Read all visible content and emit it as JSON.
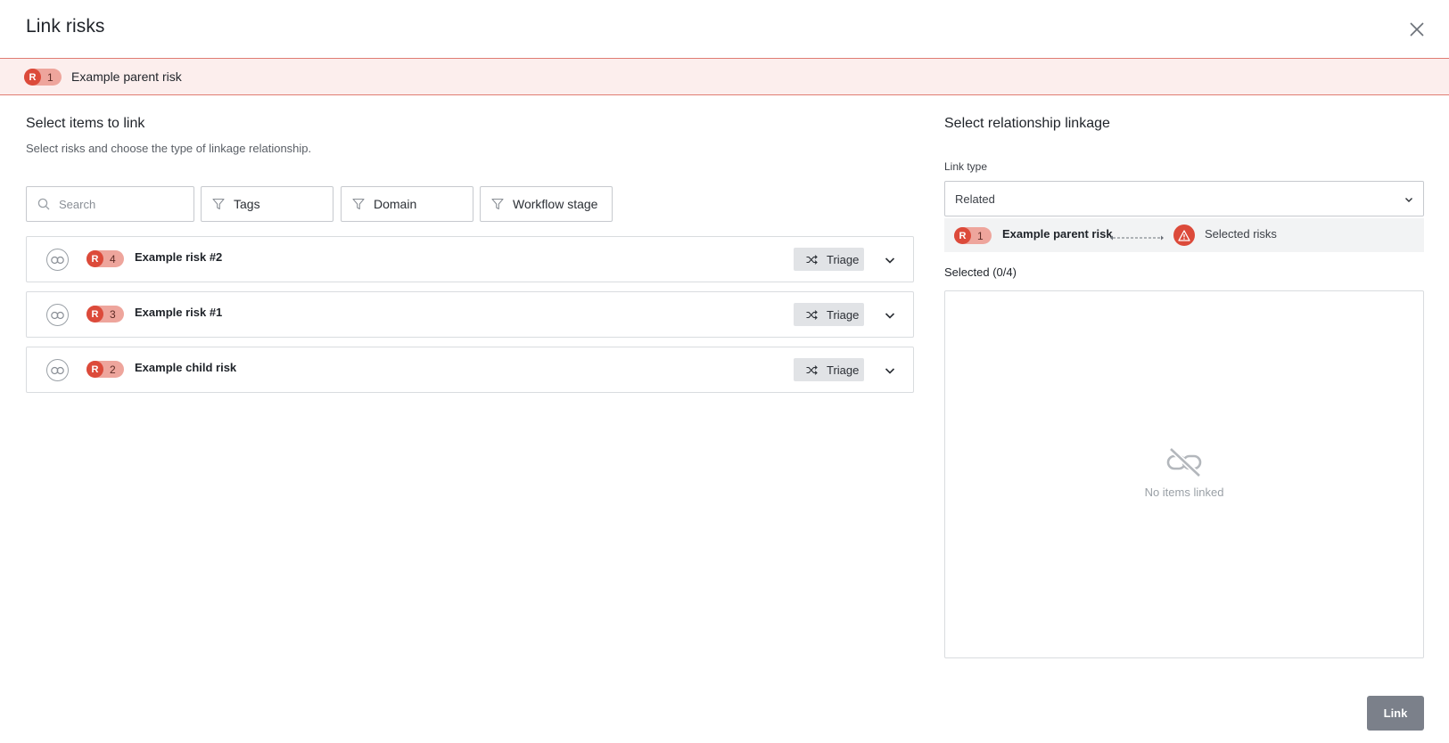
{
  "modal": {
    "title": "Link risks",
    "close_icon": "close-icon"
  },
  "parent_risk": {
    "badge_letter": "R",
    "badge_number": "1",
    "name": "Example parent risk"
  },
  "left": {
    "title": "Select items to link",
    "subtitle": "Select risks and choose the type of linkage relationship.",
    "search_placeholder": "Search",
    "filters": [
      "Tags",
      "Domain",
      "Workflow stage"
    ]
  },
  "risks": [
    {
      "badge_letter": "R",
      "badge_number": "4",
      "name": "Example risk #2",
      "stage": "Triage",
      "icon": "link-icon"
    },
    {
      "badge_letter": "R",
      "badge_number": "3",
      "name": "Example risk #1",
      "stage": "Triage",
      "icon": "link-icon"
    },
    {
      "badge_letter": "R",
      "badge_number": "2",
      "name": "Example child risk",
      "stage": "Triage",
      "icon": "link-icon"
    }
  ],
  "right": {
    "title": "Select relationship linkage",
    "link_type_label": "Link type",
    "link_type_value": "Related",
    "relation": {
      "badge_letter": "R",
      "badge_number": "1",
      "from_name": "Example parent risk",
      "to_label": "Selected risks"
    },
    "selected_label": "Selected (0/4)",
    "empty_text": "No items linked"
  },
  "footer": {
    "link_button": "Link"
  },
  "colors": {
    "risk_red": "#dc4a3a",
    "badge_pink": "#eea59c",
    "banner_bg": "#fceeed",
    "button_gray": "#7b808a"
  }
}
